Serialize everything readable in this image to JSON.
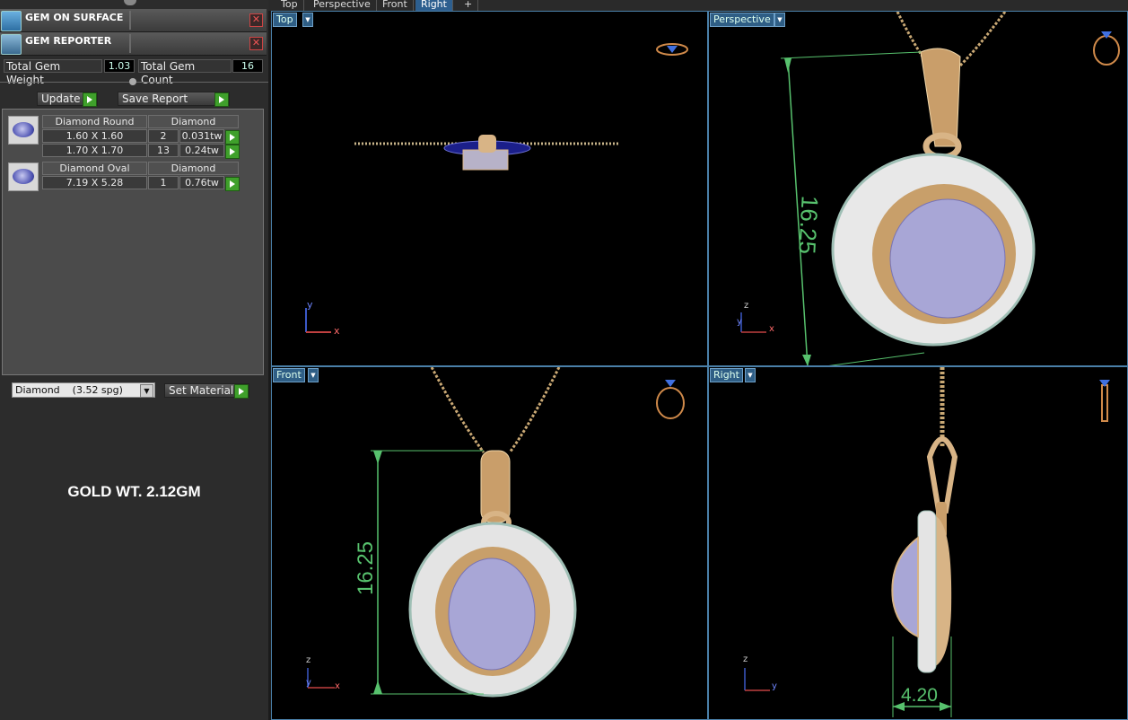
{
  "panels": [
    {
      "title": "GEM ON SURFACE"
    },
    {
      "title": "GEM REPORTER"
    }
  ],
  "metrics": {
    "weight_label": "Total Gem Weight",
    "weight_value": "1.03",
    "count_label": "Total Gem Count",
    "count_value": "16"
  },
  "actions": {
    "update": "Update",
    "save_report": "Save Report"
  },
  "gems": [
    {
      "name": "Diamond Round",
      "type": "Diamond",
      "rows": [
        {
          "size": "1.60 X 1.60",
          "count": "2",
          "weight": "0.031tw"
        },
        {
          "size": "1.70 X 1.70",
          "count": "13",
          "weight": "0.24tw"
        }
      ]
    },
    {
      "name": "Diamond Oval",
      "type": "Diamond",
      "rows": [
        {
          "size": "7.19 X 5.28",
          "count": "1",
          "weight": "0.76tw"
        }
      ]
    }
  ],
  "material": {
    "selected": "Diamond    (3.52 spg)",
    "set_label": "Set Material"
  },
  "annotation": "GOLD WT. 2.12GM",
  "view_tabs": [
    "Top",
    "Perspective",
    "Front",
    "Right",
    "+"
  ],
  "viewports": {
    "top": {
      "label": "Top",
      "axis_a": "y",
      "axis_b": "x"
    },
    "perspective": {
      "label": "Perspective",
      "axis_a": "z",
      "axis_b": "y",
      "axis_c": "x",
      "dimension": "16.25"
    },
    "front": {
      "label": "Front",
      "axis_a": "z",
      "axis_b": "y",
      "axis_c": "x",
      "dimension": "16.25"
    },
    "right": {
      "label": "Right",
      "axis_a": "z",
      "axis_b": "y",
      "dimension": "4.20"
    }
  },
  "colors": {
    "gold": "#d8b486",
    "stone": "#a8a6d6",
    "dimension": "#57c16d",
    "viewport_border": "#4a7fa8"
  }
}
